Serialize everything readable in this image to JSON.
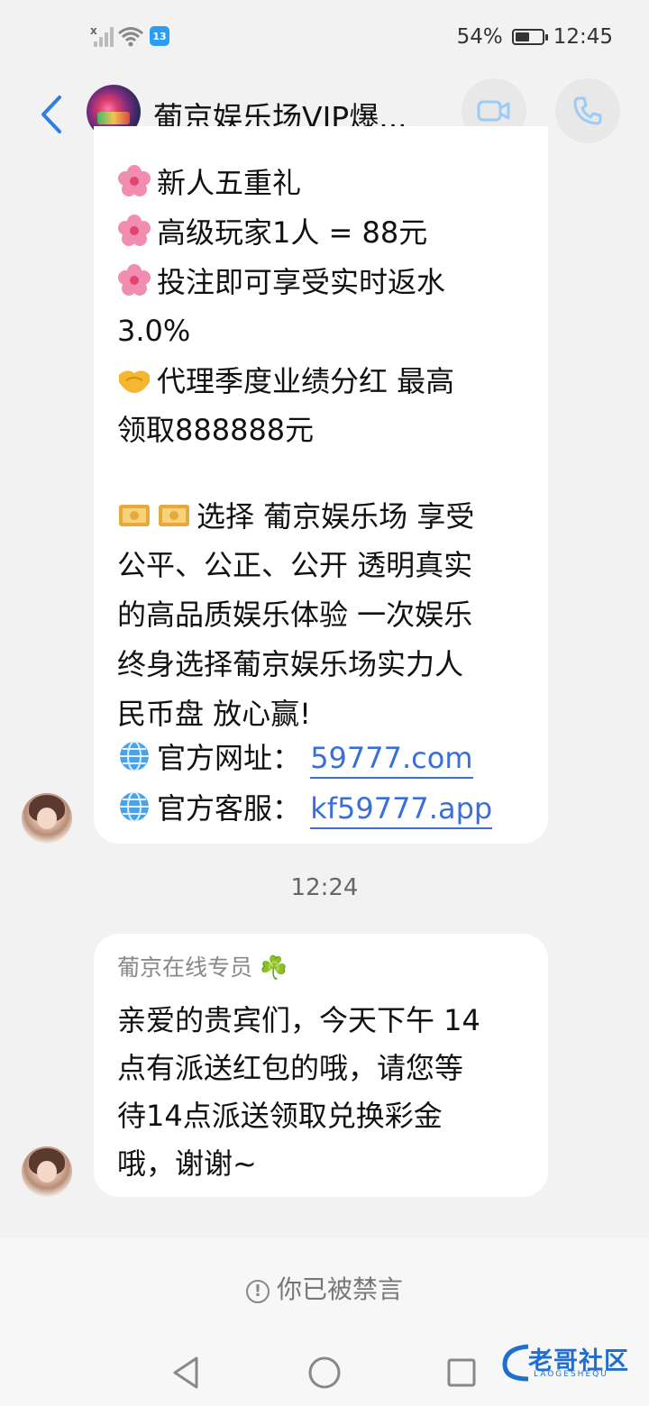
{
  "status_bar": {
    "signal_badge": "x",
    "wifi_badge": "13",
    "battery": "54%",
    "battery_level": 0.54,
    "time": "12:45"
  },
  "header": {
    "title": "葡京娱乐场VIP爆...",
    "icons": [
      "back-icon",
      "video-call-icon",
      "phone-icon"
    ]
  },
  "messages": [
    {
      "lines": [
        {
          "emoji": "cherry-blossom",
          "text": "新人五重礼"
        },
        {
          "emoji": "cherry-blossom",
          "text": "高级玩家1人 = 88元"
        },
        {
          "emoji": "cherry-blossom",
          "text": "投注即可享受实时返水"
        },
        {
          "emoji": "",
          "text": "3.0%"
        },
        {
          "emoji": "handshake",
          "text": "代理季度业绩分红 最高"
        },
        {
          "emoji": "",
          "text": "领取888888元"
        },
        {
          "emoji": "money-bag-x2",
          "text": "选择 葡京娱乐场 享受"
        },
        {
          "emoji": "",
          "text": "公平、公正、公开 透明真实"
        },
        {
          "emoji": "",
          "text": "的高品质娱乐体验 一次娱乐"
        },
        {
          "emoji": "",
          "text": "终身选择葡京娱乐场实力人"
        },
        {
          "emoji": "",
          "text": "民币盘 放心赢!"
        }
      ],
      "website_label": "官方网址：",
      "website_link": "59777.com",
      "service_label": "官方客服：",
      "service_link": "kf59777.app"
    }
  ],
  "time_divider": "12:24",
  "message2": {
    "sender": "葡京在线专员 ☘️",
    "lines": [
      "亲爱的贵宾们，今天下午 14",
      "点有派送红包的哦，请您等",
      "待14点派送领取兑换彩金",
      "哦，谢谢~"
    ]
  },
  "footer": {
    "muted_notice": "你已被禁言"
  },
  "watermark": {
    "text": "老哥社区",
    "sub": "LAOGESHEQU"
  },
  "colors": {
    "link": "#3a6fd8",
    "background": "#f2f2f2",
    "accent": "#2a9ef5"
  }
}
